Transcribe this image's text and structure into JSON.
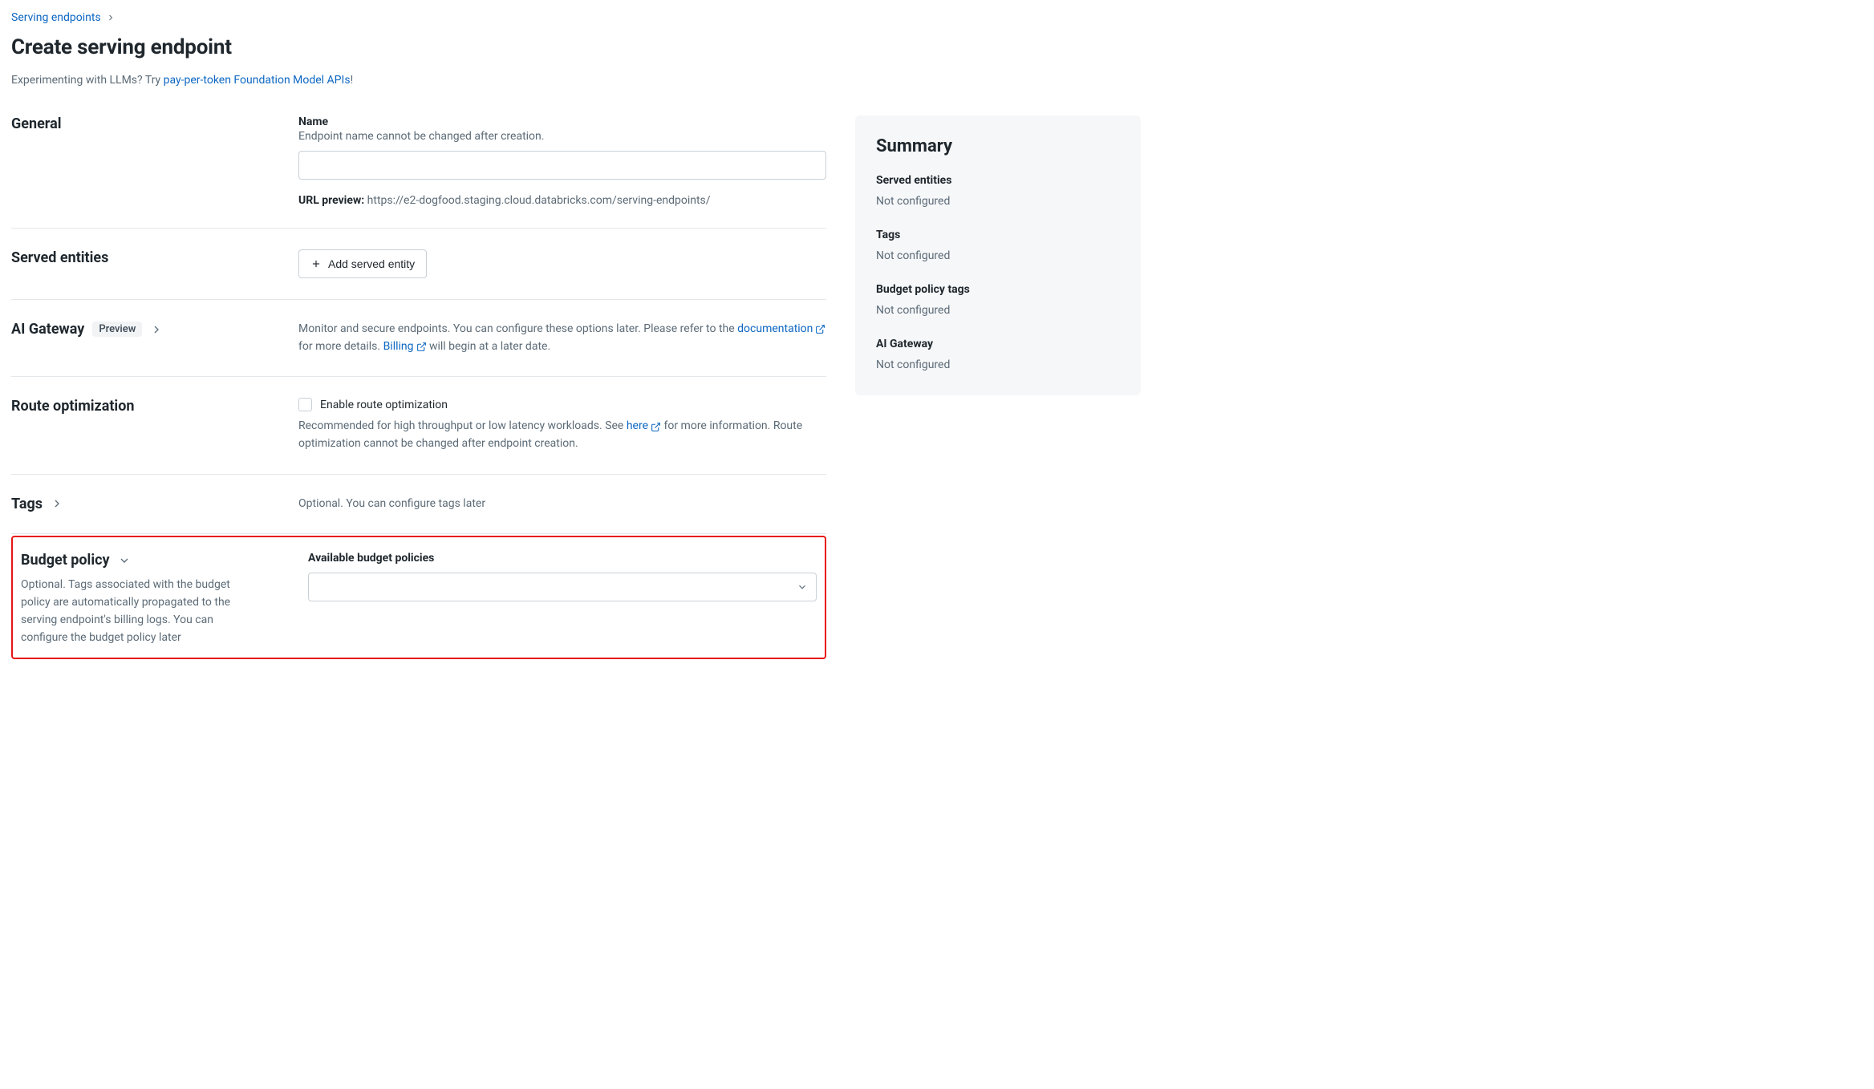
{
  "breadcrumb": {
    "parent": "Serving endpoints"
  },
  "page": {
    "title": "Create serving endpoint",
    "subline_prefix": "Experimenting with LLMs? Try ",
    "subline_link": "pay-per-token Foundation Model APIs",
    "subline_suffix": "!"
  },
  "general": {
    "heading": "General",
    "name_label": "Name",
    "name_hint": "Endpoint name cannot be changed after creation.",
    "name_value": "",
    "url_preview_label": "URL preview:",
    "url_preview_value": "https://e2-dogfood.staging.cloud.databricks.com/serving-endpoints/"
  },
  "served": {
    "heading": "Served entities",
    "add_button": "Add served entity"
  },
  "gateway": {
    "heading": "AI Gateway",
    "badge": "Preview",
    "desc_1": "Monitor and secure endpoints. You can configure these options later. Please refer to the ",
    "doc_link": "documentation",
    "desc_2": " for more details. ",
    "billing_link": "Billing",
    "desc_3": " will begin at a later date."
  },
  "route": {
    "heading": "Route optimization",
    "checkbox_label": "Enable route optimization",
    "desc_1": "Recommended for high throughput or low latency workloads. See ",
    "here_link": "here",
    "desc_2": " for more information. Route optimization cannot be changed after endpoint creation."
  },
  "tags": {
    "heading": "Tags",
    "desc": "Optional. You can configure tags later"
  },
  "budget": {
    "heading": "Budget policy",
    "sub": "Optional. Tags associated with the budget policy are automatically propagated to the serving endpoint's billing logs. You can configure the budget policy later",
    "field_label": "Available budget policies",
    "selected": ""
  },
  "summary": {
    "heading": "Summary",
    "items": [
      {
        "label": "Served entities",
        "value": "Not configured"
      },
      {
        "label": "Tags",
        "value": "Not configured"
      },
      {
        "label": "Budget policy tags",
        "value": "Not configured"
      },
      {
        "label": "AI Gateway",
        "value": "Not configured"
      }
    ]
  }
}
